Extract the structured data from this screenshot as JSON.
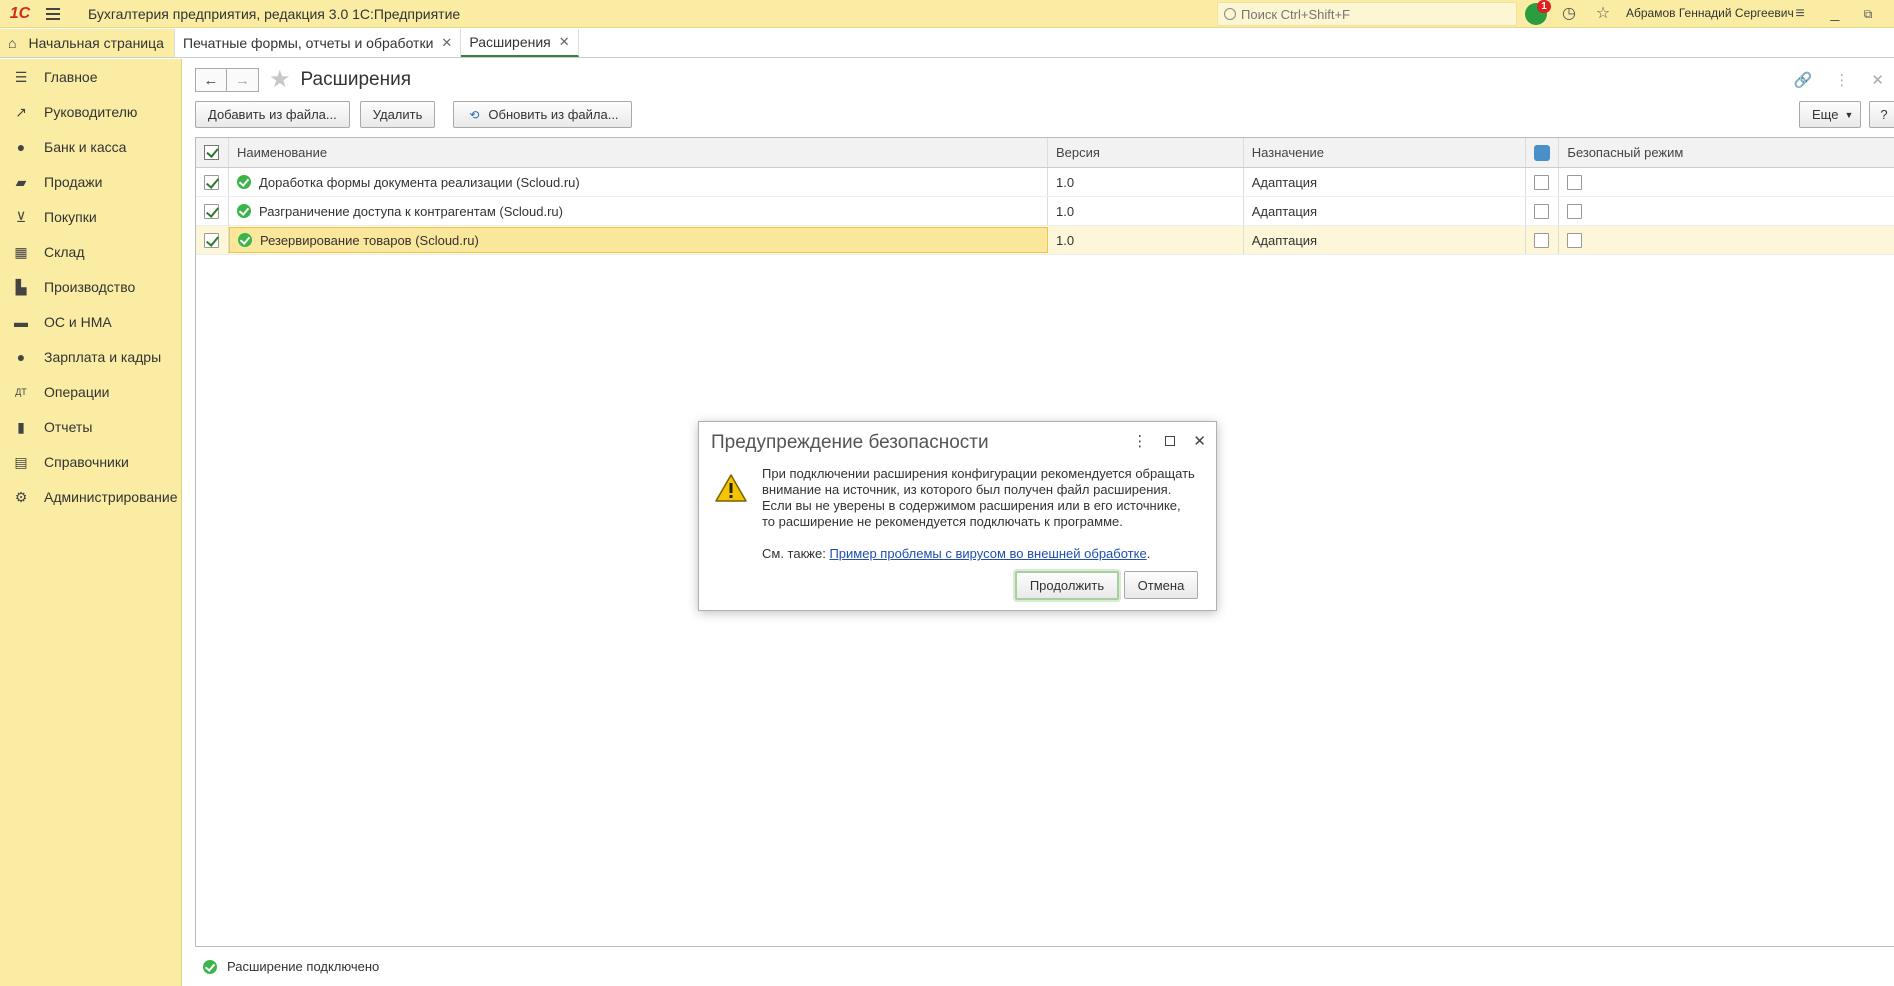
{
  "titlebar": {
    "logo": "1С",
    "app_title": "Бухгалтерия предприятия, редакция 3.0 1С:Предприятие",
    "search_placeholder": "Поиск Ctrl+Shift+F",
    "notification_count": "1",
    "user_name": "Абрамов Геннадий Сергеевич"
  },
  "tabs": [
    {
      "label": "Начальная страница"
    },
    {
      "label": "Печатные формы, отчеты и обработки"
    },
    {
      "label": "Расширения"
    }
  ],
  "sidebar": {
    "items": [
      {
        "label": "Главное",
        "icon": "menu-icon"
      },
      {
        "label": "Руководителю",
        "icon": "trend-icon"
      },
      {
        "label": "Банк и касса",
        "icon": "ruble-icon"
      },
      {
        "label": "Продажи",
        "icon": "bag-icon"
      },
      {
        "label": "Покупки",
        "icon": "cart-icon"
      },
      {
        "label": "Склад",
        "icon": "grid-icon"
      },
      {
        "label": "Производство",
        "icon": "factory-icon"
      },
      {
        "label": "ОС и НМА",
        "icon": "truck-icon"
      },
      {
        "label": "Зарплата и кадры",
        "icon": "person-icon"
      },
      {
        "label": "Операции",
        "icon": "dt-kt-icon"
      },
      {
        "label": "Отчеты",
        "icon": "bar-chart-icon"
      },
      {
        "label": "Справочники",
        "icon": "book-icon"
      },
      {
        "label": "Администрирование",
        "icon": "gear-icon"
      }
    ]
  },
  "page": {
    "title": "Расширения"
  },
  "toolbar": {
    "add_label": "Добавить из файла...",
    "delete_label": "Удалить",
    "update_label": "Обновить из файла...",
    "more_label": "Еще",
    "help_label": "?"
  },
  "table": {
    "columns": [
      "Наименование",
      "Версия",
      "Назначение",
      "Безопасный режим"
    ],
    "rows": [
      {
        "name": "Доработка формы документа реализации (Scloud.ru)",
        "version": "1.0",
        "purpose": "Адаптация"
      },
      {
        "name": "Разграничение доступа к контрагентам (Scloud.ru)",
        "version": "1.0",
        "purpose": "Адаптация"
      },
      {
        "name": "Резервирование товаров (Scloud.ru)",
        "version": "1.0",
        "purpose": "Адаптация"
      }
    ]
  },
  "status": {
    "text": "Расширение подключено"
  },
  "dialog": {
    "title": "Предупреждение безопасности",
    "lines": [
      "При подключении расширения конфигурации рекомендуется обращать",
      "внимание на источник, из которого был получен файл расширения.",
      "Если вы не уверены в содержимом расширения или в его источнике,",
      "то расширение не рекомендуется подключать к программе."
    ],
    "see_also_label": "См. также:",
    "see_also_link": "Пример проблемы с вирусом во внешней обработке",
    "continue_label": "Продолжить",
    "cancel_label": "Отмена"
  }
}
